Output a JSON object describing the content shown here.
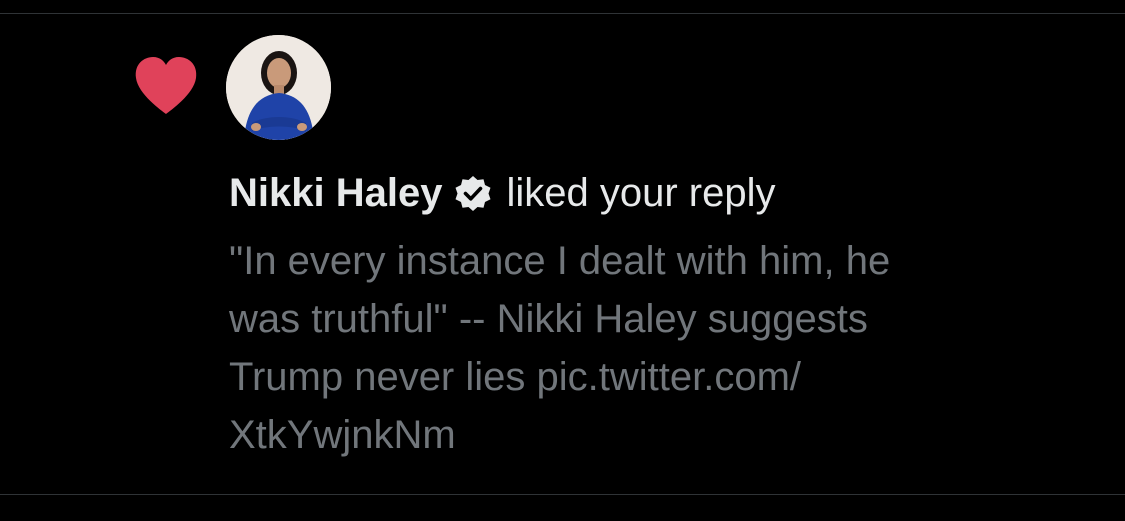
{
  "notification": {
    "type_icon": "heart-icon",
    "avatar_icon": "avatar",
    "author_name": "Nikki Haley",
    "verified_icon": "verified-badge-icon",
    "action_text": "liked your reply",
    "tweet_text": "\"In every instance I dealt with him, he\nwas truthful\" -- Nikki Haley suggests\nTrump never lies pic.twitter.com/\nXtkYwjnkNm"
  },
  "colors": {
    "background": "#000000",
    "heart": "#e0425a",
    "primary_text": "#e7e9ea",
    "secondary_text": "#71767b",
    "divider": "#2f3336"
  }
}
